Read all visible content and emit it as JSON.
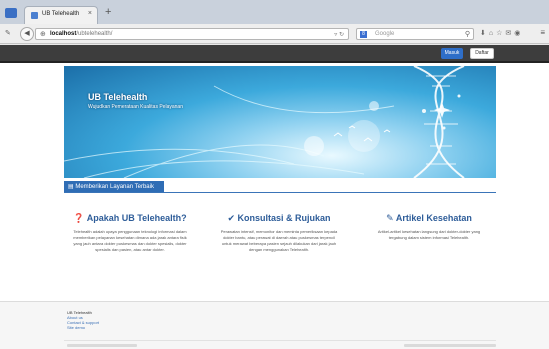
{
  "browser": {
    "tab_title": "UB Telehealth",
    "tab_close": "×",
    "new_tab": "+",
    "url_host": "localhost",
    "url_path": "/ubtelehealth/",
    "search_placeholder": "Google",
    "search_engine_badge": "8"
  },
  "topbar": {
    "login_label": "Masuk",
    "register_label": "Daftar"
  },
  "hero": {
    "title": "UB Telehealth",
    "subtitle": "Wujudkan Pemerataan Kualitas Pelayanan"
  },
  "section": {
    "title": "Memberikan Layanan Terbaik"
  },
  "features": [
    {
      "icon": "question-circle-icon",
      "title": "Apakah UB Telehealth?",
      "body": "Telehealth adalah upaya penggunaan teknologi informasi dalam memberikan pelayanan kesehatan dimana ada jarak antara fisik yang jauh antara dokter puskesmas dan dokter spesialis, dokter spesialis dan pasien, atau antar dokter."
    },
    {
      "icon": "check-circle-icon",
      "title": "Konsultasi & Rujukan",
      "body": "Perawatan intensif, memonitor dan meminta pemeriksaan kepada dokter bantu, atau perawat di daerah atau puskesmas terpencil untuk merawat beberapa pasien sejauh dilakukan dari jarak jauh dengan menggunakan Telehealth."
    },
    {
      "icon": "pencil-icon",
      "title": "Artikel Kesehatan",
      "body": "Artikel-artikel kesehatan langsung dari dokter-dokter yang tergabung dalam sistem informasi Telehealth."
    }
  ],
  "footer": {
    "title": "UB Telehealth",
    "links": [
      "About us",
      "Contact & support",
      "Site demo"
    ]
  },
  "colors": {
    "primary": "#2e6ec8",
    "topbar": "#3d3d3d",
    "heading": "#2e5d99",
    "section_bar": "#2f6db5"
  }
}
